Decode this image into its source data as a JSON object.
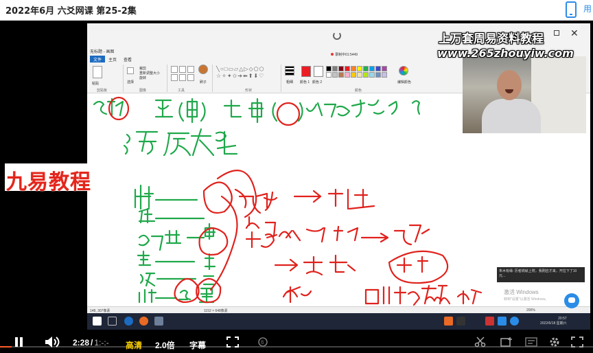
{
  "window": {
    "title": "2022年6月 六爻网课 第25-2集",
    "mobile_icon": "phone-icon",
    "partial_text": "用"
  },
  "video": {
    "watermark_line1": "上万套周易资料教程",
    "watermark_line2": "www.265zhouyiw.com",
    "brand_banner": "九易教程",
    "paint": {
      "quick_access": "无标题 - 画图",
      "tabs": [
        "文件",
        "主页",
        "查看"
      ],
      "recording_id": "录制中01:5449",
      "groups": [
        "剪贴板",
        "图像",
        "工具",
        "形状",
        "颜色"
      ],
      "labels": {
        "brush": "刷子",
        "size": "粗细",
        "color1": "颜色 1",
        "color2": "颜色 2",
        "edit_colors": "编辑颜色",
        "crop": "裁剪",
        "resize": "重新调整大小",
        "rotate": "旋转",
        "select": "选择",
        "paste": "粘贴"
      },
      "palette": [
        "#000000",
        "#7f7f7f",
        "#880015",
        "#ed1c24",
        "#ff7f27",
        "#fff200",
        "#22b14c",
        "#00a2e8",
        "#3f48cc",
        "#a349a4",
        "#ffffff",
        "#c3c3c3",
        "#b97a57",
        "#ffaec9",
        "#ffc90e",
        "#efe4b0",
        "#b5e61d",
        "#99d9ea",
        "#7092be",
        "#c8bfe7"
      ],
      "status_left": "148, 307像素",
      "status_mid": "1152 × 648像素",
      "zoom": "200%"
    },
    "toast_text": "朱木有缘: 历者祸就上附，我刚应才来，开拉下了10元...",
    "activate_title": "激活 Windows",
    "activate_sub": "转到\"设置\"以激活 Windows。",
    "clock": "20:57\n2022/6/18 星期六"
  },
  "controls": {
    "current_time": "2:28",
    "separator": "/",
    "duration": "1:-:-",
    "quality": "高清",
    "speed": "2.0倍",
    "subtitle": "字幕",
    "progress": 0.02,
    "icons": [
      "pause-icon",
      "volume-icon",
      "fullscreen-frame-icon",
      "replay-icon",
      "scissors-icon",
      "add-to-list-icon",
      "danmaku-icon",
      "settings-icon",
      "fullscreen-icon"
    ]
  }
}
